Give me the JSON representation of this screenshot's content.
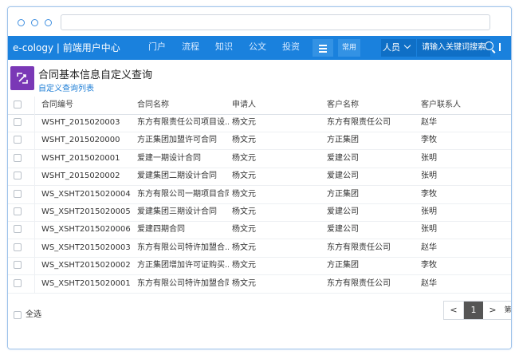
{
  "nav": {
    "brand": "e-cology | 前端用户中心",
    "items": [
      {
        "label": "门户"
      },
      {
        "label": "流程"
      },
      {
        "label": "知识"
      },
      {
        "label": "公文"
      },
      {
        "label": "投资"
      }
    ],
    "common_label": "常用",
    "user_label": "人员",
    "search_placeholder": "请输入关键词搜索"
  },
  "header": {
    "title": "合同基本信息自定义查询",
    "subtitle": "自定义查询列表"
  },
  "table": {
    "columns": [
      "合同编号",
      "合同名称",
      "申请人",
      "客户名称",
      "客户联系人"
    ],
    "rows": [
      [
        "WSHT_2015020003",
        "东方有限责任公司项目设...",
        "杨文元",
        "东方有限责任公司",
        "赵华"
      ],
      [
        "WSHT_2015020000",
        "方正集团加盟许可合同",
        "杨文元",
        "方正集团",
        "李牧"
      ],
      [
        "WSHT_2015020001",
        "爱建一期设计合同",
        "杨文元",
        "爱建公司",
        "张明"
      ],
      [
        "WSHT_2015020002",
        "爱建集团二期设计合同",
        "杨文元",
        "爱建公司",
        "张明"
      ],
      [
        "WS_XSHT2015020004",
        "东方有限公司一期项目合同",
        "杨文元",
        "方正集团",
        "李牧"
      ],
      [
        "WS_XSHT2015020005",
        "爱建集团三期设计合同",
        "杨文元",
        "爱建公司",
        "张明"
      ],
      [
        "WS_XSHT2015020006",
        "爱建四期合同",
        "杨文元",
        "爱建公司",
        "张明"
      ],
      [
        "WS_XSHT2015020003",
        "东方有限公司特许加盟合...",
        "杨文元",
        "东方有限责任公司",
        "赵华"
      ],
      [
        "WS_XSHT2015020002",
        "方正集团增加许可证购买...",
        "杨文元",
        "方正集团",
        "李牧"
      ],
      [
        "WS_XSHT2015020001",
        "东方有限公司特许加盟合同",
        "杨文元",
        "东方有限责任公司",
        "赵华"
      ]
    ]
  },
  "footer": {
    "select_all_label": "全选",
    "pager": {
      "prev": "<",
      "current": "1",
      "next": ">",
      "first": "第"
    }
  },
  "colors": {
    "nav_bg": "#1a81dd",
    "nav_dark": "#0f6fc6",
    "app_icon": "#7a38b6",
    "link": "#1c7dd6",
    "window_border": "#9fc3ea"
  }
}
